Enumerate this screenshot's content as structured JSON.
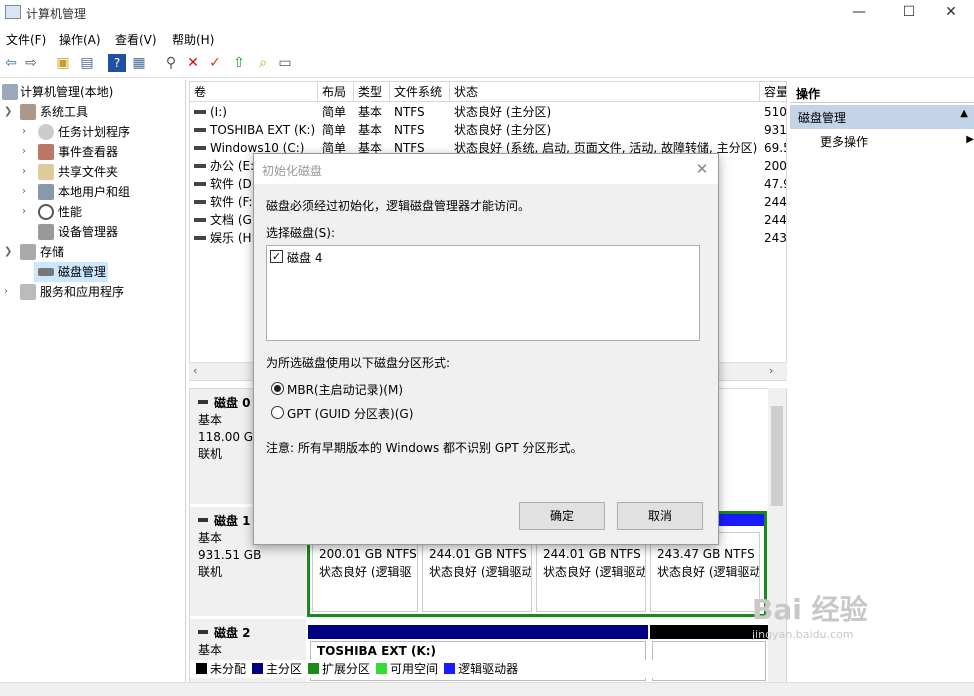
{
  "window": {
    "title": "计算机管理",
    "minimize": "—",
    "maximize": "☐",
    "close": "✕"
  },
  "menu": [
    "文件(F)",
    "操作(A)",
    "查看(V)",
    "帮助(H)"
  ],
  "tree": {
    "root": "计算机管理(本地)",
    "system_tools": "系统工具",
    "task_scheduler": "任务计划程序",
    "event_viewer": "事件查看器",
    "shared_folders": "共享文件夹",
    "local_users": "本地用户和组",
    "performance": "性能",
    "device_manager": "设备管理器",
    "storage": "存储",
    "disk_management": "磁盘管理",
    "services_apps": "服务和应用程序"
  },
  "volumes": {
    "headers": [
      "卷",
      "布局",
      "类型",
      "文件系统",
      "状态",
      "容量"
    ],
    "rows": [
      [
        "(I:)",
        "简单",
        "基本",
        "NTFS",
        "状态良好 (主分区)",
        "510"
      ],
      [
        "TOSHIBA EXT (K:)",
        "简单",
        "基本",
        "NTFS",
        "状态良好 (主分区)",
        "931"
      ],
      [
        "Windows10 (C:)",
        "简单",
        "基本",
        "NTFS",
        "状态良好 (系统, 启动, 页面文件, 活动, 故障转储, 主分区)",
        "69.5"
      ],
      [
        "办公 (E:)",
        "",
        "",
        "",
        "",
        "200"
      ],
      [
        "软件 (D:)",
        "",
        "",
        "",
        "",
        "47.9"
      ],
      [
        "软件 (F:)",
        "",
        "",
        "",
        "",
        "244"
      ],
      [
        "文档 (G:)",
        "",
        "",
        "",
        "",
        "244"
      ],
      [
        "娱乐 (H:)",
        "",
        "",
        "",
        "",
        "243"
      ]
    ]
  },
  "disks": [
    {
      "name": "磁盘 0",
      "type": "基本",
      "size": "118.00 GB",
      "status": "联机"
    },
    {
      "name": "磁盘 1",
      "type": "基本",
      "size": "931.51 GB",
      "status": "联机"
    },
    {
      "name": "磁盘 2",
      "type": "基本"
    }
  ],
  "disk1_parts": [
    {
      "size": "200.01 GB NTFS",
      "status": "状态良好 (逻辑驱"
    },
    {
      "size": "244.01 GB NTFS",
      "status": "状态良好 (逻辑驱动"
    },
    {
      "size": "244.01 GB NTFS",
      "status": "状态良好 (逻辑驱动"
    },
    {
      "size": "243.47 GB NTFS",
      "status": "状态良好 (逻辑驱动"
    }
  ],
  "disk2_part": "TOSHIBA EXT  (K:)",
  "legend": [
    {
      "label": "未分配",
      "color": "#000000"
    },
    {
      "label": "主分区",
      "color": "#000080"
    },
    {
      "label": "扩展分区",
      "color": "#1a8a1a"
    },
    {
      "label": "可用空间",
      "color": "#33dd33"
    },
    {
      "label": "逻辑驱动器",
      "color": "#1a1aff"
    }
  ],
  "actions": {
    "title": "操作",
    "section": "磁盘管理",
    "more": "更多操作"
  },
  "dialog": {
    "title": "初始化磁盘",
    "message": "磁盘必须经过初始化，逻辑磁盘管理器才能访问。",
    "select_label": "选择磁盘(S):",
    "disk_item": "磁盘 4",
    "style_label": "为所选磁盘使用以下磁盘分区形式:",
    "mbr": "MBR(主启动记录)(M)",
    "gpt": "GPT (GUID 分区表)(G)",
    "note": "注意: 所有早期版本的 Windows 都不识别 GPT 分区形式。",
    "ok": "确定",
    "cancel": "取消"
  },
  "watermark": "Bai 经验",
  "watermark_url": "jingyan.baidu.com"
}
